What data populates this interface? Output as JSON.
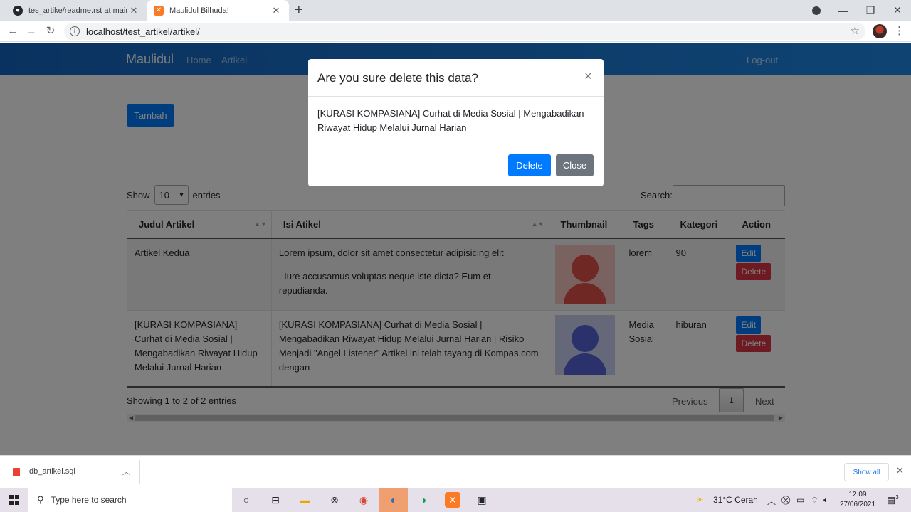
{
  "browser": {
    "tabs": [
      {
        "title": "tes_artike/readme.rst at main · M",
        "icon": "github-icon"
      },
      {
        "title": "Maulidul Bilhuda!",
        "icon": "xampp-icon"
      }
    ],
    "url": "localhost/test_artikel/artikel/"
  },
  "navbar": {
    "brand": "Maulidul",
    "links": [
      "Home",
      "Artikel"
    ],
    "logout": "Log-out"
  },
  "toolbar": {
    "add_label": "Tambah"
  },
  "table_controls": {
    "show_label": "Show",
    "page_size": "10",
    "entries_label": "entries",
    "search_label": "Search:"
  },
  "table": {
    "columns": [
      "Judul Artikel",
      "Isi Atikel",
      "Thumbnail",
      "Tags",
      "Kategori",
      "Action"
    ],
    "rows": [
      {
        "judul": "Artikel Kedua",
        "isi_p1": "Lorem ipsum, dolor sit amet consectetur adipisicing elit",
        "isi_p2": ". Iure accusamus voluptas neque iste dicta? Eum et repudianda.",
        "tags": "lorem",
        "kategori": "90",
        "edit": "Edit",
        "delete": "Delete"
      },
      {
        "judul": "[KURASI KOMPASIANA] Curhat di Media Sosial | Mengabadikan Riwayat Hidup Melalui Jurnal Harian",
        "isi_p1": "[KURASI KOMPASIANA] Curhat di Media Sosial | Mengabadikan Riwayat Hidup Melalui Jurnal Harian | Risiko Menjadi \"Angel Listener\"  Artikel ini telah tayang di Kompas.com dengan",
        "tags": "Media Sosial",
        "kategori": "hiburan",
        "edit": "Edit",
        "delete": "Delete"
      }
    ]
  },
  "footer": {
    "info": "Showing 1 to 2 of 2 entries",
    "previous": "Previous",
    "page": "1",
    "next": "Next"
  },
  "modal": {
    "title": "Are you sure delete this data?",
    "close_symbol": "×",
    "body": "[KURASI KOMPASIANA] Curhat di Media Sosial | Mengabadikan Riwayat Hidup Melalui Jurnal Harian",
    "delete_label": "Delete",
    "close_label": "Close"
  },
  "downloads": {
    "file": "db_artikel.sql",
    "show_all": "Show all"
  },
  "taskbar": {
    "search_placeholder": "Type here to search",
    "weather": "31°C  Cerah",
    "time": "12.09",
    "date": "27/06/2021",
    "notification_count": "3"
  },
  "colors": {
    "primary": "#007bff",
    "danger": "#dc3545",
    "secondary": "#6c757d",
    "navbar": "#1e88e5"
  }
}
